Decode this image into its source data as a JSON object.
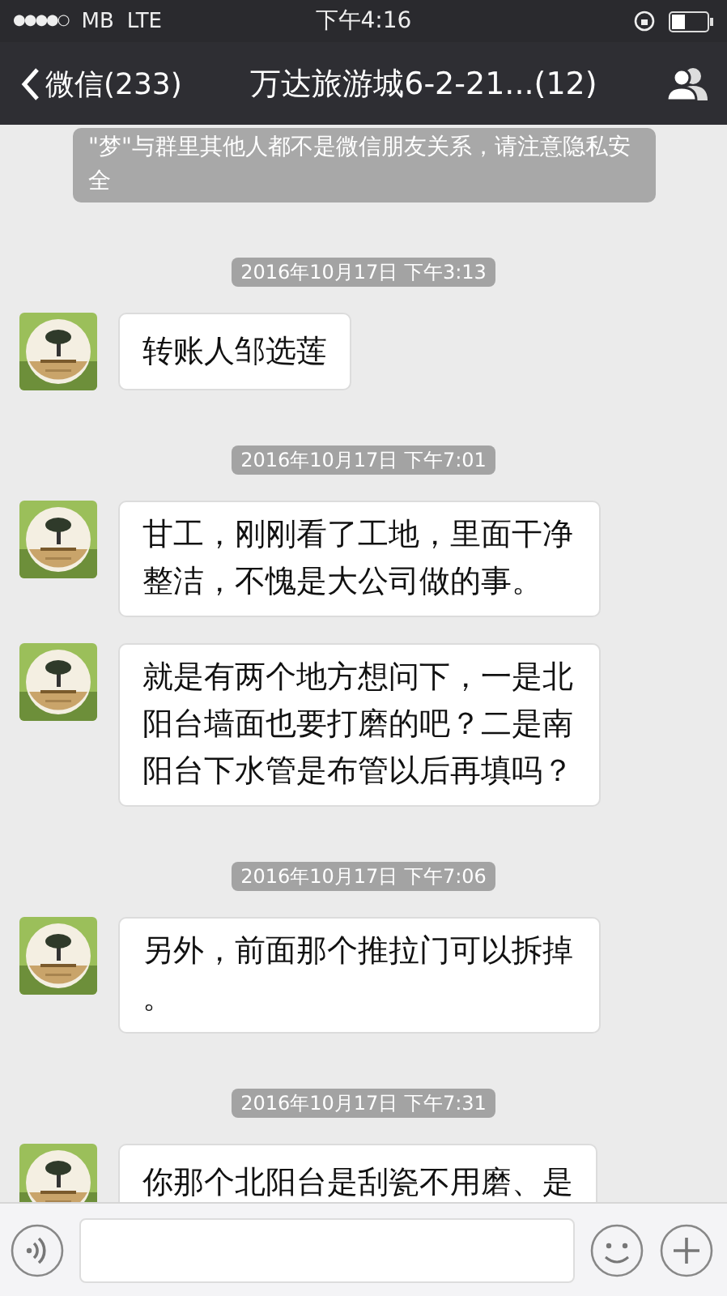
{
  "status_bar": {
    "signal": "●●●●○",
    "carrier": "MB",
    "network": "LTE",
    "time": "下午4:16"
  },
  "nav": {
    "back": "微信(233)",
    "title": "万达旅游城6-2-21...(12)"
  },
  "notice": "\"梦\"与群里其他人都不是微信朋友关系，请注意隐私安全",
  "messages": [
    {
      "kind": "time",
      "text": "2016年10月17日 下午3:13"
    },
    {
      "kind": "message",
      "text": "转账人邹选莲"
    },
    {
      "kind": "time",
      "text": "2016年10月17日 下午7:01"
    },
    {
      "kind": "message",
      "text": "甘工，刚刚看了工地，里面干净整洁，不愧是大公司做的事。"
    },
    {
      "kind": "message",
      "text": "就是有两个地方想问下，一是北阳台墙面也要打磨的吧？二是南阳台下水管是布管以后再填吗？"
    },
    {
      "kind": "time",
      "text": "2016年10月17日 下午7:06"
    },
    {
      "kind": "message",
      "text": "另外，前面那个推拉门可以拆掉。"
    },
    {
      "kind": "time",
      "text": "2016年10月17日 下午7:31"
    },
    {
      "kind": "message",
      "text": "你那个北阳台是刮瓷不用磨、是"
    }
  ]
}
